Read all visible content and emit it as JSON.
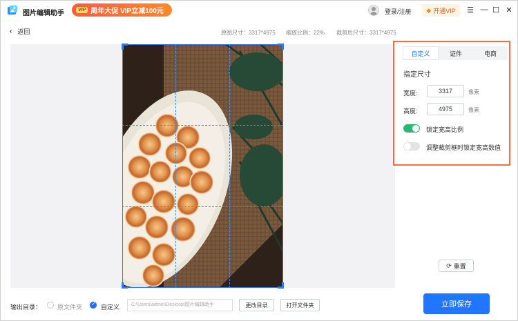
{
  "app": {
    "title": "图片编辑助手"
  },
  "promo": {
    "badge": "VIP",
    "text": "周年大促 VIP立减100元"
  },
  "header": {
    "login": "登录/注册",
    "vip_button": "开通VIP"
  },
  "window_controls": {
    "menu": "☰",
    "minimize": "—",
    "maximize": "☐",
    "close": "✕"
  },
  "toolbar": {
    "back_label": "返回",
    "original_size": "原图尺寸：3317*4975",
    "zoom_ratio": "缩放比例：22%",
    "cropped_size": "裁剪后尺寸：3317*4975"
  },
  "panel": {
    "tabs": [
      {
        "label": "自定义",
        "active": true
      },
      {
        "label": "证件",
        "active": false
      },
      {
        "label": "电商",
        "active": false
      }
    ],
    "section_title": "指定尺寸",
    "width_label": "宽度:",
    "width_value": "3317",
    "width_unit": "像素",
    "height_label": "高度:",
    "height_value": "4975",
    "height_unit": "像素",
    "lock_ratio_label": "锁定宽高比例",
    "lock_ratio_on": true,
    "lock_value_label": "调整裁剪框时锁定宽高数值",
    "lock_value_on": false,
    "accent": "#ff6a3d"
  },
  "reset_button": "重置",
  "bottom": {
    "output_label": "输出目录：",
    "option_original": "原文件夹",
    "option_custom": "自定义",
    "path": "C:\\Users\\admin\\Desktop\\图片编辑助手",
    "change_dir": "更改目录",
    "open_folder": "打开文件夹",
    "save": "立即保存"
  },
  "colors": {
    "primary": "#2176ff",
    "toggle_on": "#2bb673"
  }
}
